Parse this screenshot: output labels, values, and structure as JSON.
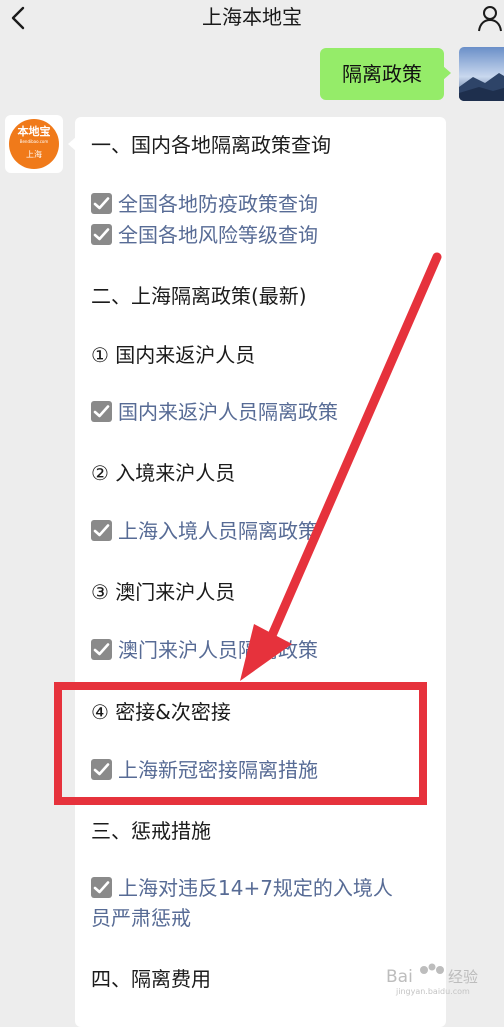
{
  "header": {
    "title": "上海本地宝"
  },
  "sent_message": {
    "text": "隔离政策"
  },
  "bot_logo": {
    "name": "本地宝",
    "sub": "Bendibao.com",
    "city": "上海"
  },
  "reply": {
    "section1": "一、国内各地隔离政策查询",
    "link1": "全国各地防疫政策查询",
    "link2": "全国各地风险等级查询",
    "section2": "二、上海隔离政策(最新)",
    "sub1": "① 国内来返沪人员",
    "link3": "国内来返沪人员隔离政策",
    "sub2": "② 入境来沪人员",
    "link4": "上海入境人员隔离政策",
    "sub3": "③ 澳门来沪人员",
    "link5": "澳门来沪人员隔离政策",
    "sub4": "④ 密接&次密接",
    "link6": "上海新冠密接隔离措施",
    "section3": "三、惩戒措施",
    "link7": "上海对违反14+7规定的入境人员严肃惩戒",
    "section4": "四、隔离费用"
  },
  "colors": {
    "link": "#576b95",
    "bubble_sent": "#95ec69",
    "annotation": "#e6323c",
    "logo": "#f07a1a"
  },
  "icons": {
    "back": "chevron-left-icon",
    "profile": "user-icon",
    "checkbox": "checkbox-checked-icon"
  }
}
